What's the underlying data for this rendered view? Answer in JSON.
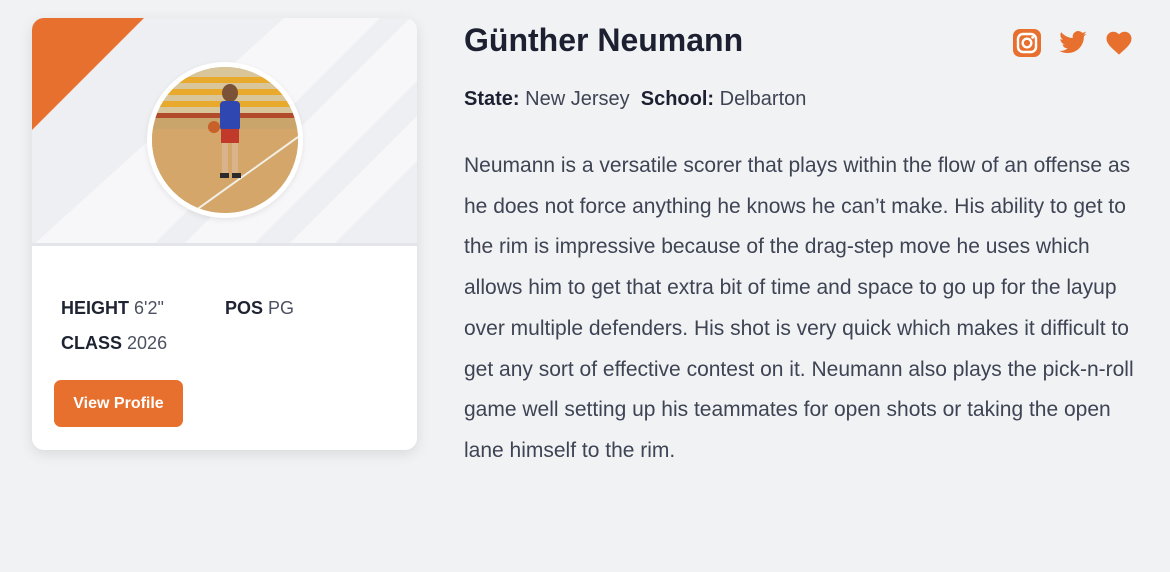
{
  "player": {
    "name": "Günther Neumann",
    "state_label": "State:",
    "state": "New Jersey",
    "school_label": "School:",
    "school": "Delbarton",
    "bio": "Neumann is a versatile scorer that plays within the flow of an offense as he does not force anything he knows he can’t make. His ability to get to the rim is impressive because of the drag-step move he uses which allows him to get that extra bit of time and space to go up for the layup over multiple defenders. His shot is very quick which makes it difficult to get any sort of effective contest on it. Neumann also plays the pick-n-roll game well setting up his teammates for open shots or taking the open lane himself to the rim."
  },
  "card": {
    "height_label": "HEIGHT",
    "height_value": "6'2\"",
    "pos_label": "POS",
    "pos_value": "PG",
    "class_label": "CLASS",
    "class_value": "2026",
    "button_label": "View Profile"
  },
  "social": {
    "icons": [
      "instagram-icon",
      "twitter-icon",
      "heart-icon"
    ]
  },
  "colors": {
    "accent": "#e8702f",
    "background": "#f1f2f4",
    "text_dark": "#1c2030",
    "text_body": "#3e4454"
  }
}
